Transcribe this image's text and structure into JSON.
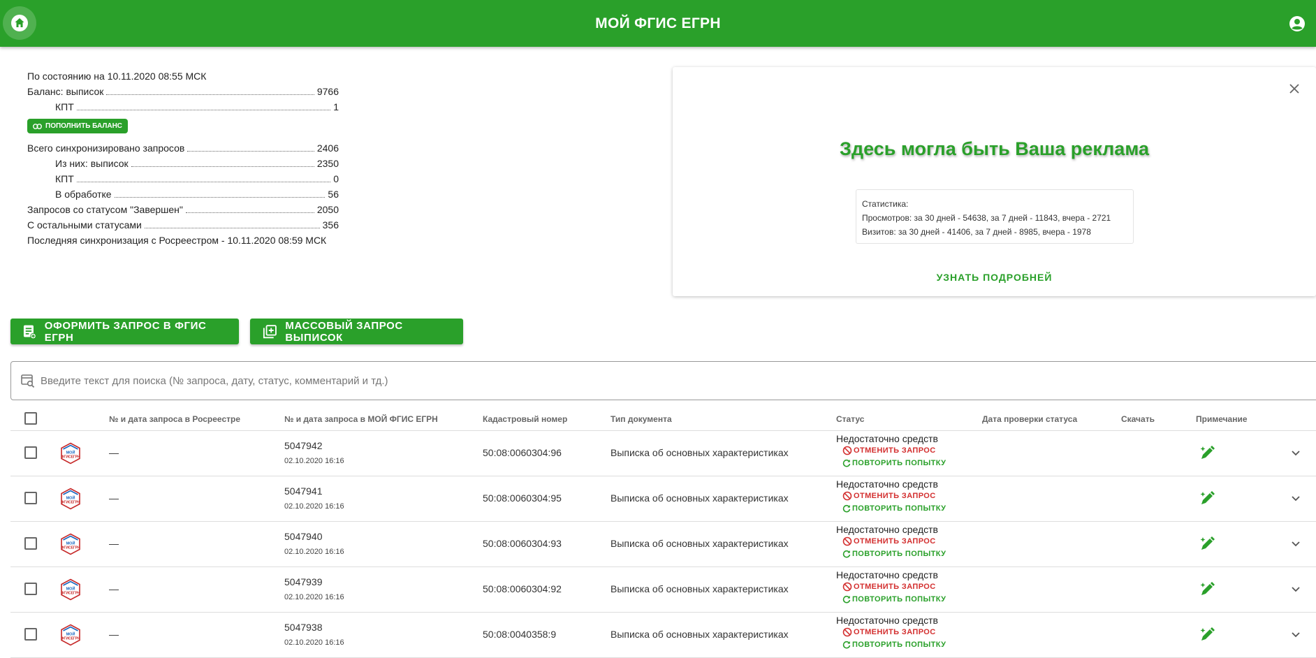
{
  "header": {
    "title": "МОЙ ФГИС ЕГРН"
  },
  "stats": {
    "as_of": "По состоянию на 10.11.2020 08:55 МСК",
    "balance_label": "Баланс: выписок",
    "balance_value": "9766",
    "kpt_label": "КПТ",
    "kpt_value": "1",
    "topup_label": "ПОПОЛНИТЬ БАЛАНС",
    "synced_label": "Всего синхронизировано запросов",
    "synced_value": "2406",
    "of_them_label": "Из них: выписок",
    "of_them_value": "2350",
    "kpt2_label": "КПТ",
    "kpt2_value": "0",
    "processing_label": "В обработке",
    "processing_value": "56",
    "completed_label": "Запросов со статусом \"Завершен\"",
    "completed_value": "2050",
    "other_label": "С остальными статусами",
    "other_value": "356",
    "last_sync": "Последняя синхронизация с Росреестром - 10.11.2020 08:59 МСК"
  },
  "ad": {
    "headline": "Здесь могла быть Ваша реклама",
    "stats_title": "Статистика:",
    "views": "Просмотров: за 30 дней - 54638, за 7 дней - 11843, вчера - 2721",
    "visits": "Визитов: за 30 дней - 41406, за 7 дней - 8985, вчера - 1978",
    "more": "УЗНАТЬ ПОДРОБНЕЙ"
  },
  "actions": {
    "new_request": "ОФОРМИТЬ ЗАПРОС В ФГИС ЕГРН",
    "bulk_request": "МАССОВЫЙ ЗАПРОС ВЫПИСОК"
  },
  "search": {
    "placeholder": "Введите текст для поиска (№ запроса, дату, статус, комментарий и тд.)"
  },
  "table": {
    "headers": {
      "rosreestr": "№ и дата запроса в Росреестре",
      "own": "№ и дата запроса в МОЙ ФГИС ЕГРН",
      "cadastral": "Кадастровый номер",
      "doc_type": "Тип документа",
      "status": "Статус",
      "check_date": "Дата проверки статуса",
      "download": "Скачать",
      "note": "Примечание"
    },
    "cancel_label": "ОТМЕНИТЬ ЗАПРОС",
    "retry_label": "ПОВТОРИТЬ ПОПЫТКУ",
    "rows": [
      {
        "rosreestr": "—",
        "num": "5047942",
        "date": "02.10.2020 16:16",
        "cadastral": "50:08:0060304:96",
        "doc_type": "Выписка об основных характеристиках",
        "status": "Недостаточно средств"
      },
      {
        "rosreestr": "—",
        "num": "5047941",
        "date": "02.10.2020 16:16",
        "cadastral": "50:08:0060304:95",
        "doc_type": "Выписка об основных характеристиках",
        "status": "Недостаточно средств"
      },
      {
        "rosreestr": "—",
        "num": "5047940",
        "date": "02.10.2020 16:16",
        "cadastral": "50:08:0060304:93",
        "doc_type": "Выписка об основных характеристиках",
        "status": "Недостаточно средств"
      },
      {
        "rosreestr": "—",
        "num": "5047939",
        "date": "02.10.2020 16:16",
        "cadastral": "50:08:0060304:92",
        "doc_type": "Выписка об основных характеристиках",
        "status": "Недостаточно средств"
      },
      {
        "rosreestr": "—",
        "num": "5047938",
        "date": "02.10.2020 16:16",
        "cadastral": "50:08:0040358:9",
        "doc_type": "Выписка об основных характеристиках",
        "status": "Недостаточно средств"
      }
    ]
  },
  "colors": {
    "brand_green": "#2aa02a",
    "cancel_red": "#d32f2f"
  }
}
